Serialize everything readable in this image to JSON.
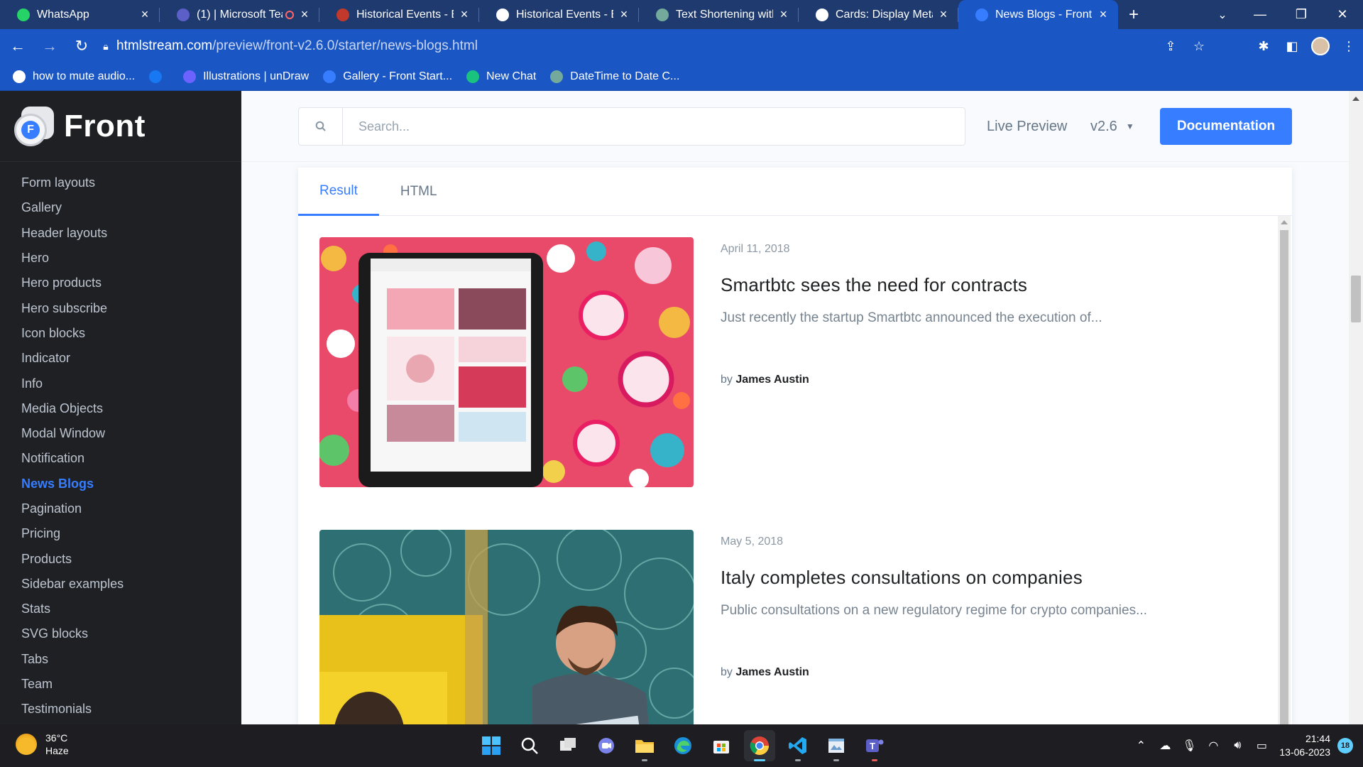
{
  "tabs": [
    {
      "title": "WhatsApp",
      "favicon": "whatsapp-icon",
      "color": "#25d366",
      "active": false
    },
    {
      "title": "(1) | Microsoft Tea",
      "favicon": "teams-icon",
      "color": "#5b5fc7",
      "active": false,
      "recording": true
    },
    {
      "title": "Historical Events - Exp",
      "favicon": "history-icon",
      "color": "#c0392b",
      "active": false
    },
    {
      "title": "Historical Events - Exp",
      "favicon": "globe-icon",
      "color": "#ffffff",
      "active": false
    },
    {
      "title": "Text Shortening with",
      "favicon": "openai-icon",
      "color": "#74aa9c",
      "active": false
    },
    {
      "title": "Cards: Display Meta (",
      "favicon": "globe-icon",
      "color": "#ffffff",
      "active": false
    },
    {
      "title": "News Blogs - Front St",
      "favicon": "front-icon",
      "color": "#377dff",
      "active": true
    }
  ],
  "address": {
    "host": "htmlstream.com",
    "path": "/preview/front-v2.6.0/starter/news-blogs.html"
  },
  "bookmarks": [
    {
      "label": "how to mute audio...",
      "icon": "google-icon",
      "color": "#ffffff"
    },
    {
      "label": "",
      "icon": "facebook-icon",
      "color": "#1877f2"
    },
    {
      "label": "Illustrations | unDraw",
      "icon": "undraw-icon",
      "color": "#6c63ff"
    },
    {
      "label": "Gallery - Front Start...",
      "icon": "front-icon",
      "color": "#377dff"
    },
    {
      "label": "New Chat",
      "icon": "chat-icon",
      "color": "#19c37d"
    },
    {
      "label": "DateTime to Date C...",
      "icon": "openai-icon",
      "color": "#74aa9c"
    }
  ],
  "sidebar": {
    "brand": "Front",
    "items": [
      {
        "label": "Form layouts"
      },
      {
        "label": "Gallery"
      },
      {
        "label": "Header layouts"
      },
      {
        "label": "Hero"
      },
      {
        "label": "Hero products"
      },
      {
        "label": "Hero subscribe"
      },
      {
        "label": "Icon blocks"
      },
      {
        "label": "Indicator"
      },
      {
        "label": "Info"
      },
      {
        "label": "Media Objects"
      },
      {
        "label": "Modal Window"
      },
      {
        "label": "Notification"
      },
      {
        "label": "News Blogs",
        "active": true
      },
      {
        "label": "Pagination"
      },
      {
        "label": "Pricing"
      },
      {
        "label": "Products"
      },
      {
        "label": "Sidebar examples"
      },
      {
        "label": "Stats"
      },
      {
        "label": "SVG blocks"
      },
      {
        "label": "Tabs"
      },
      {
        "label": "Team"
      },
      {
        "label": "Testimonials"
      }
    ]
  },
  "topbar": {
    "search_placeholder": "Search...",
    "live_preview": "Live Preview",
    "version": "v2.6",
    "documentation": "Documentation"
  },
  "content_tabs": {
    "result": "Result",
    "html": "HTML"
  },
  "posts": [
    {
      "date": "April 11, 2018",
      "title": "Smartbtc sees the need for contracts",
      "excerpt": "Just recently the startup Smartbtc announced the execution of...",
      "by": "by",
      "author": "James Austin"
    },
    {
      "date": "May 5, 2018",
      "title": "Italy completes consultations on companies",
      "excerpt": "Public consultations on a new regulatory regime for crypto companies...",
      "by": "by",
      "author": "James Austin"
    }
  ],
  "taskbar": {
    "temperature": "36°C",
    "condition": "Haze",
    "time": "21:44",
    "date": "13-06-2023",
    "notifications": "18",
    "apps": [
      "start-icon",
      "search-icon",
      "task-view-icon",
      "meet-icon",
      "file-explorer-icon",
      "edge-icon",
      "store-icon",
      "chrome-icon",
      "vscode-icon",
      "photos-icon",
      "teams-icon"
    ]
  }
}
